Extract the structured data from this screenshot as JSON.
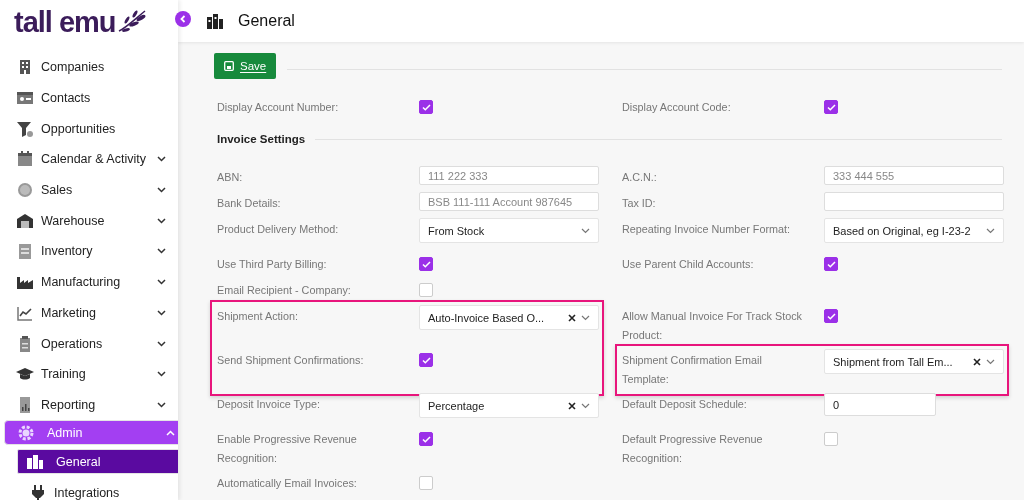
{
  "logo": {
    "text": "tall emu"
  },
  "sidebar": {
    "items": [
      {
        "label": "Companies",
        "has_submenu": false,
        "selected": false
      },
      {
        "label": "Contacts",
        "has_submenu": false,
        "selected": false
      },
      {
        "label": "Opportunities",
        "has_submenu": false,
        "selected": false
      },
      {
        "label": "Calendar & Activity",
        "has_submenu": true,
        "expanded": false,
        "selected": false
      },
      {
        "label": "Sales",
        "has_submenu": true,
        "expanded": false,
        "selected": false
      },
      {
        "label": "Warehouse",
        "has_submenu": true,
        "expanded": false,
        "selected": false
      },
      {
        "label": "Inventory",
        "has_submenu": true,
        "expanded": false,
        "selected": false
      },
      {
        "label": "Manufacturing",
        "has_submenu": true,
        "expanded": false,
        "selected": false
      },
      {
        "label": "Marketing",
        "has_submenu": true,
        "expanded": false,
        "selected": false
      },
      {
        "label": "Operations",
        "has_submenu": true,
        "expanded": false,
        "selected": false
      },
      {
        "label": "Training",
        "has_submenu": true,
        "expanded": false,
        "selected": false
      },
      {
        "label": "Reporting",
        "has_submenu": true,
        "expanded": false,
        "selected": false
      },
      {
        "label": "Admin",
        "has_submenu": true,
        "expanded": true,
        "selected": true,
        "children": [
          {
            "label": "General",
            "selected": true
          },
          {
            "label": "Integrations",
            "selected": false
          }
        ]
      }
    ]
  },
  "header": {
    "title": "General"
  },
  "save_button": {
    "label": "Save"
  },
  "sections": [
    {
      "rows": [
        {
          "left": {
            "label": "Display Account Number:",
            "kind": "checkbox",
            "checked": true
          },
          "right": {
            "label": "Display Account Code:",
            "kind": "checkbox",
            "checked": true
          }
        }
      ]
    },
    {
      "title": "Invoice Settings",
      "rows": [
        {
          "left": {
            "label": "ABN:",
            "kind": "text",
            "placeholder": "111 222 333"
          },
          "right": {
            "label": "A.C.N.:",
            "kind": "text",
            "placeholder": "333 444 555"
          }
        },
        {
          "left": {
            "label": "Bank Details:",
            "kind": "text",
            "placeholder": "BSB 111-111 Account 987645"
          },
          "right": {
            "label": "Tax ID:",
            "kind": "text"
          }
        },
        {
          "left": {
            "label": "Product Delivery Method:",
            "kind": "select",
            "value": "From Stock",
            "clearable": false
          },
          "right": {
            "label": "Repeating Invoice Number Format:",
            "kind": "select",
            "value": "Based on Original, eg I-23-2",
            "clearable": false
          }
        },
        {
          "left": {
            "label": "Use Third Party Billing:",
            "kind": "checkbox",
            "checked": true
          },
          "right": {
            "label": "Use Parent Child Accounts:",
            "kind": "checkbox",
            "checked": true
          }
        },
        {
          "left": {
            "label": "Email Recipient - Company:",
            "kind": "checkbox",
            "checked": false
          }
        },
        {
          "left": {
            "label": "Shipment Action:",
            "kind": "select",
            "value": "Auto-Invoice Based O...",
            "clearable": true,
            "highlighted": true
          },
          "right": {
            "label": "Allow Manual Invoice For Track Stock Product:",
            "kind": "checkbox",
            "checked": true
          }
        },
        {
          "left": {
            "label": "Send Shipment Confirmations:",
            "kind": "checkbox",
            "checked": true,
            "highlighted": true
          },
          "right": {
            "label": "Shipment Confirmation Email Template:",
            "kind": "select",
            "value": "Shipment from Tall Em...",
            "clearable": true,
            "highlighted": true
          }
        },
        {
          "left": {
            "label": "Deposit Invoice Type:",
            "kind": "select",
            "value": "Percentage",
            "clearable": true
          },
          "right": {
            "label": "Default Deposit Schedule:",
            "kind": "number",
            "value": "0"
          }
        },
        {
          "left": {
            "label": "Enable Progressive Revenue Recognition:",
            "kind": "checkbox",
            "checked": true
          },
          "right": {
            "label": "Default Progressive Revenue Recognition:",
            "kind": "checkbox",
            "checked": false
          }
        },
        {
          "left": {
            "label": "Automatically Email Invoices:",
            "kind": "checkbox",
            "checked": false
          }
        }
      ]
    }
  ]
}
